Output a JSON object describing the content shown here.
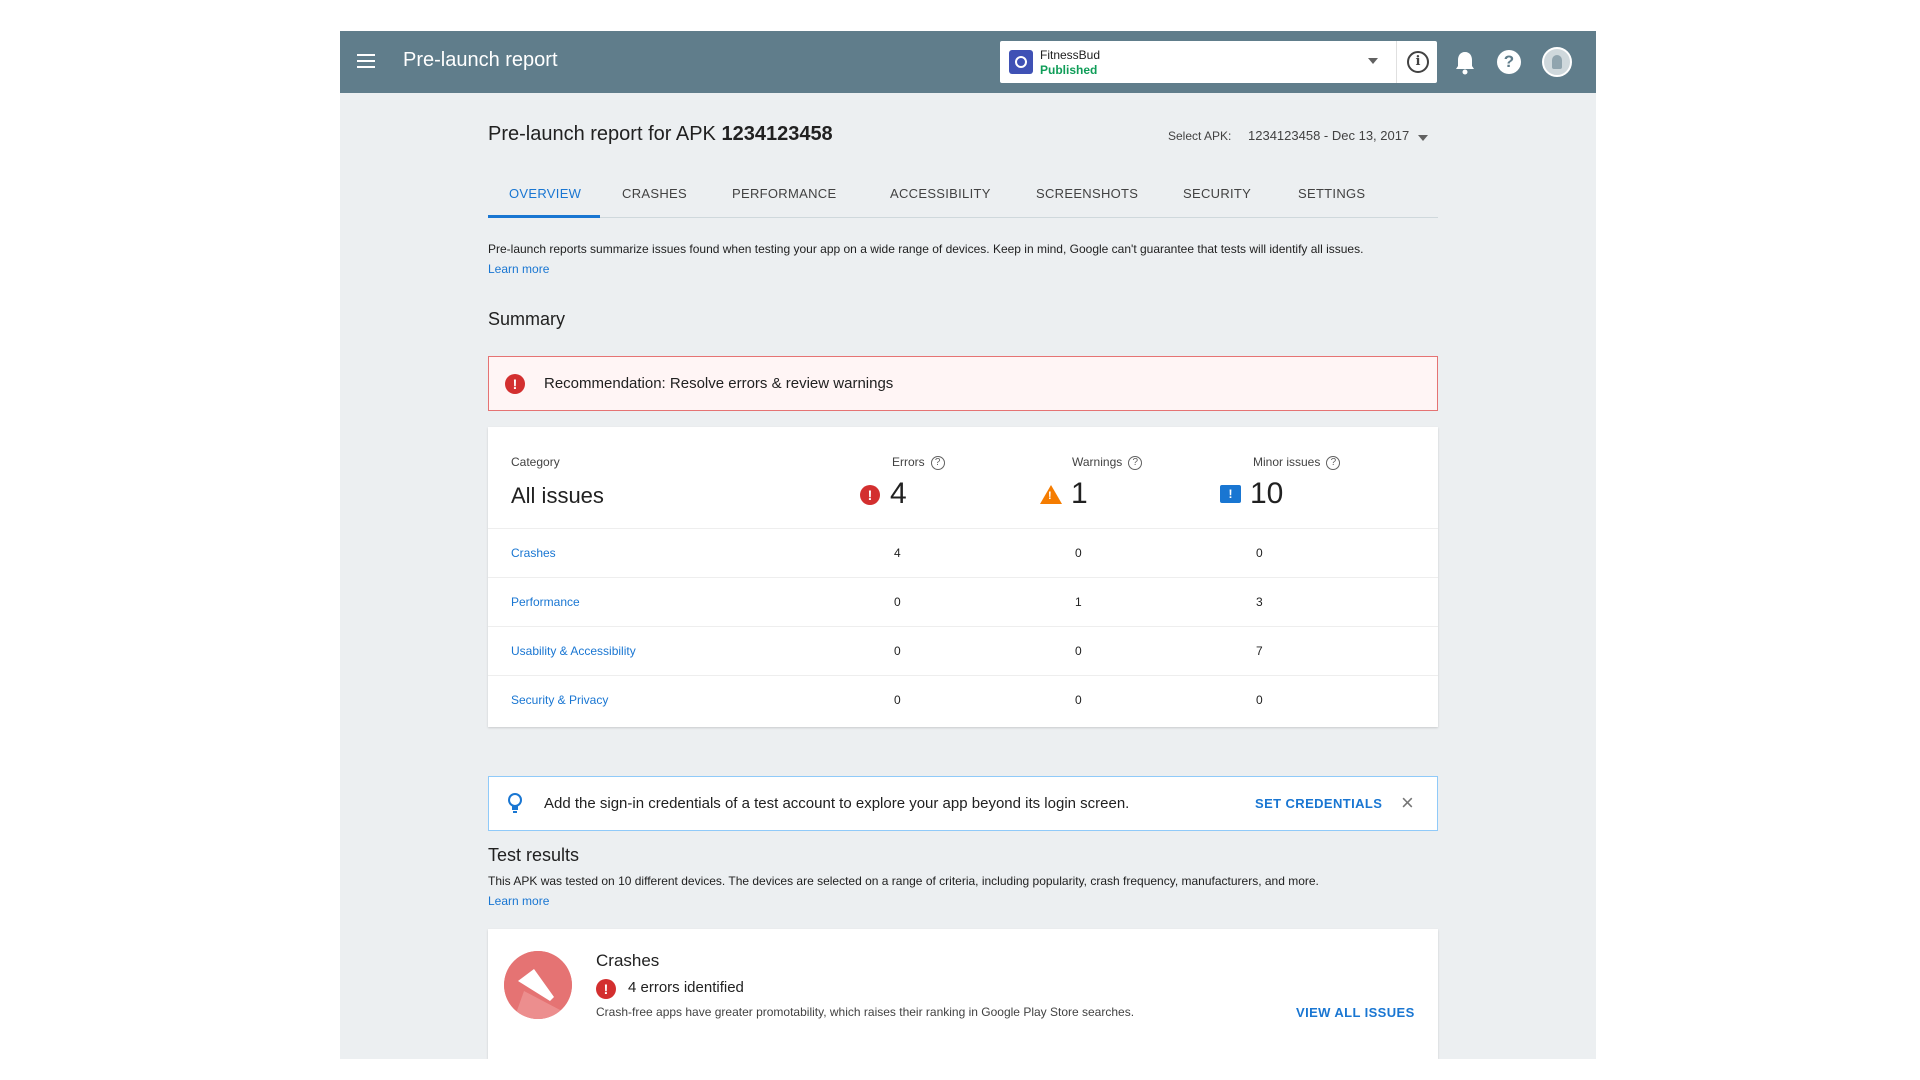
{
  "header": {
    "page_title": "Pre-launch report",
    "app_name": "FitnessBud",
    "app_status": "Published",
    "colors": {
      "bar": "#607d8b",
      "accent": "#1976d2"
    },
    "icons": [
      "menu-icon",
      "info-icon",
      "bell-icon",
      "help-icon",
      "avatar"
    ]
  },
  "report": {
    "title_prefix": "Pre-launch report for APK ",
    "apk_number": "1234123458",
    "select_label": "Select APK:",
    "select_value": "1234123458 - Dec 13, 2017"
  },
  "tabs": [
    {
      "label": "OVERVIEW",
      "active": true
    },
    {
      "label": "CRASHES"
    },
    {
      "label": "PERFORMANCE"
    },
    {
      "label": "ACCESSIBILITY"
    },
    {
      "label": "SCREENSHOTS"
    },
    {
      "label": "SECURITY"
    },
    {
      "label": "SETTINGS"
    }
  ],
  "intro": {
    "text": "Pre-launch reports summarize issues found when testing your app on a wide range of devices. Keep in mind, Google can't guarantee that tests will identify all issues.",
    "learn_more": "Learn more"
  },
  "summary": {
    "title": "Summary",
    "recommendation": "Recommendation: Resolve errors & review warnings",
    "headers": {
      "category": "Category",
      "errors": "Errors",
      "warnings": "Warnings",
      "minor": "Minor issues"
    },
    "all_label": "All issues",
    "totals": {
      "errors": "4",
      "warnings": "1",
      "minor": "10"
    },
    "rows": [
      {
        "category": "Crashes",
        "errors": "4",
        "warnings": "0",
        "minor": "0"
      },
      {
        "category": "Performance",
        "errors": "0",
        "warnings": "1",
        "minor": "3"
      },
      {
        "category": "Usability & Accessibility",
        "errors": "0",
        "warnings": "0",
        "minor": "7"
      },
      {
        "category": "Security & Privacy",
        "errors": "0",
        "warnings": "0",
        "minor": "0"
      }
    ]
  },
  "credentials": {
    "text": "Add the sign-in credentials of a test account to explore your app beyond its login screen.",
    "button": "SET CREDENTIALS"
  },
  "test_results": {
    "title": "Test results",
    "desc": "This APK was tested on 10 different devices. The devices are selected on a range of criteria, including popularity, crash frequency, manufacturers, and more.",
    "learn_more": "Learn more",
    "crashes": {
      "title": "Crashes",
      "errors": "4 errors identified",
      "desc": "Crash-free apps have greater promotability, which raises their ranking in Google Play Store searches.",
      "button": "VIEW ALL ISSUES"
    }
  }
}
